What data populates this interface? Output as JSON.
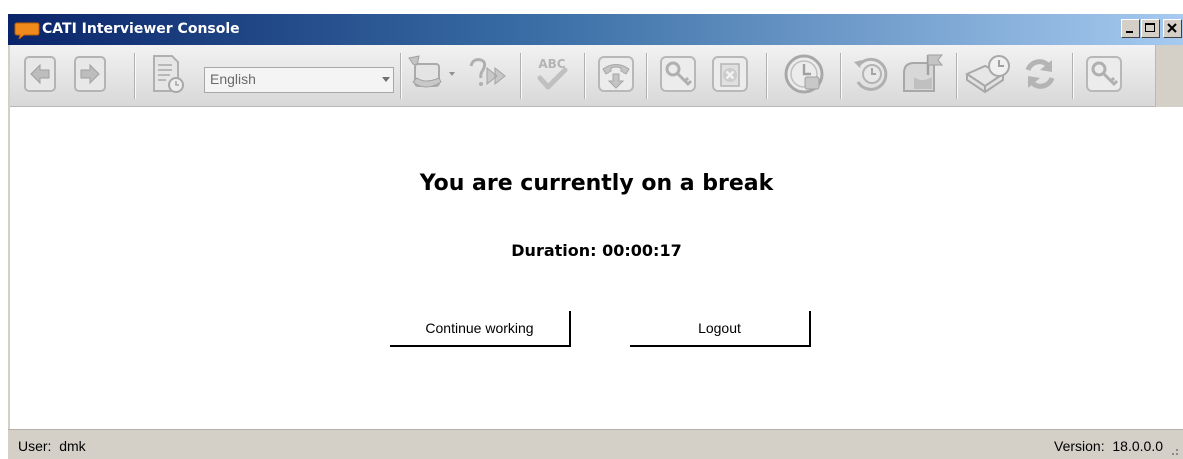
{
  "window": {
    "title": "CATI Interviewer Console",
    "controls": {
      "minimize": "minimize-icon",
      "maximize": "maximize-icon",
      "close": "close-icon"
    }
  },
  "toolbar": {
    "language": "English",
    "icons": [
      "back-arrow-icon",
      "forward-arrow-icon",
      "document-clock-icon",
      "phone-transfer-icon",
      "skip-forward-icon",
      "spell-check-icon",
      "hang-up-phone-icon",
      "key-icon",
      "cancel-document-icon",
      "break-timer-icon",
      "callback-clock-icon",
      "mailbox-flag-icon",
      "appointment-book-icon",
      "refresh-icon",
      "search-key-icon"
    ]
  },
  "main": {
    "heading": "You are currently on a break",
    "duration_label": "Duration:",
    "duration_value": "00:00:17",
    "continue_label": "Continue working",
    "logout_label": "Logout"
  },
  "status": {
    "user_label": "User:",
    "user_value": "dmk",
    "version_label": "Version:",
    "version_value": "18.0.0.0"
  },
  "colors": {
    "titlebar_start": "#0a246a",
    "titlebar_end": "#a6caf0",
    "toolbar_icon": "#a8a8a8",
    "chrome": "#d4d0c8"
  }
}
